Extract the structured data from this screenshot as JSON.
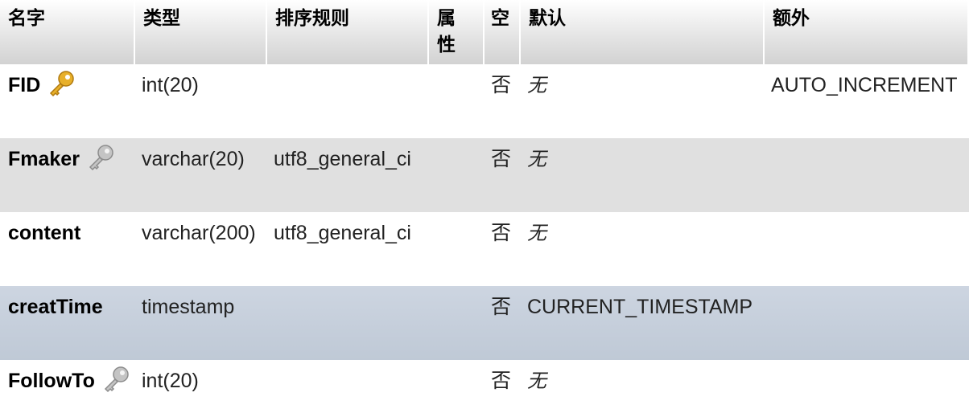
{
  "headers": {
    "name": "名字",
    "type": "类型",
    "collation": "排序规则",
    "attributes": "属\n性",
    "null": "空",
    "default": "默认",
    "extra": "额外"
  },
  "rows": [
    {
      "name": "FID",
      "key_icon": "primary-key-icon",
      "type": "int(20)",
      "collation": "",
      "attributes": "",
      "null": "否",
      "default": "无",
      "extra": "AUTO_INCREMENT"
    },
    {
      "name": "Fmaker",
      "key_icon": "index-key-icon",
      "type": "varchar(20)",
      "collation": "utf8_general_ci",
      "attributes": "",
      "null": "否",
      "default": "无",
      "extra": ""
    },
    {
      "name": "content",
      "key_icon": "",
      "type": "varchar(200)",
      "collation": "utf8_general_ci",
      "attributes": "",
      "null": "否",
      "default": "无",
      "extra": ""
    },
    {
      "name": "creatTime",
      "key_icon": "",
      "type": "timestamp",
      "collation": "",
      "attributes": "",
      "null": "否",
      "default": "CURRENT_TIMESTAMP",
      "extra": ""
    },
    {
      "name": "FollowTo",
      "key_icon": "index-key-icon",
      "type": "int(20)",
      "collation": "",
      "attributes": "",
      "null": "否",
      "default": "无",
      "extra": ""
    }
  ],
  "colors": {
    "primary_key": "#e8b02a",
    "index_key": "#a8a8a8",
    "row_even": "#e0e0e0",
    "row_highlight": "#c6cfdb"
  }
}
